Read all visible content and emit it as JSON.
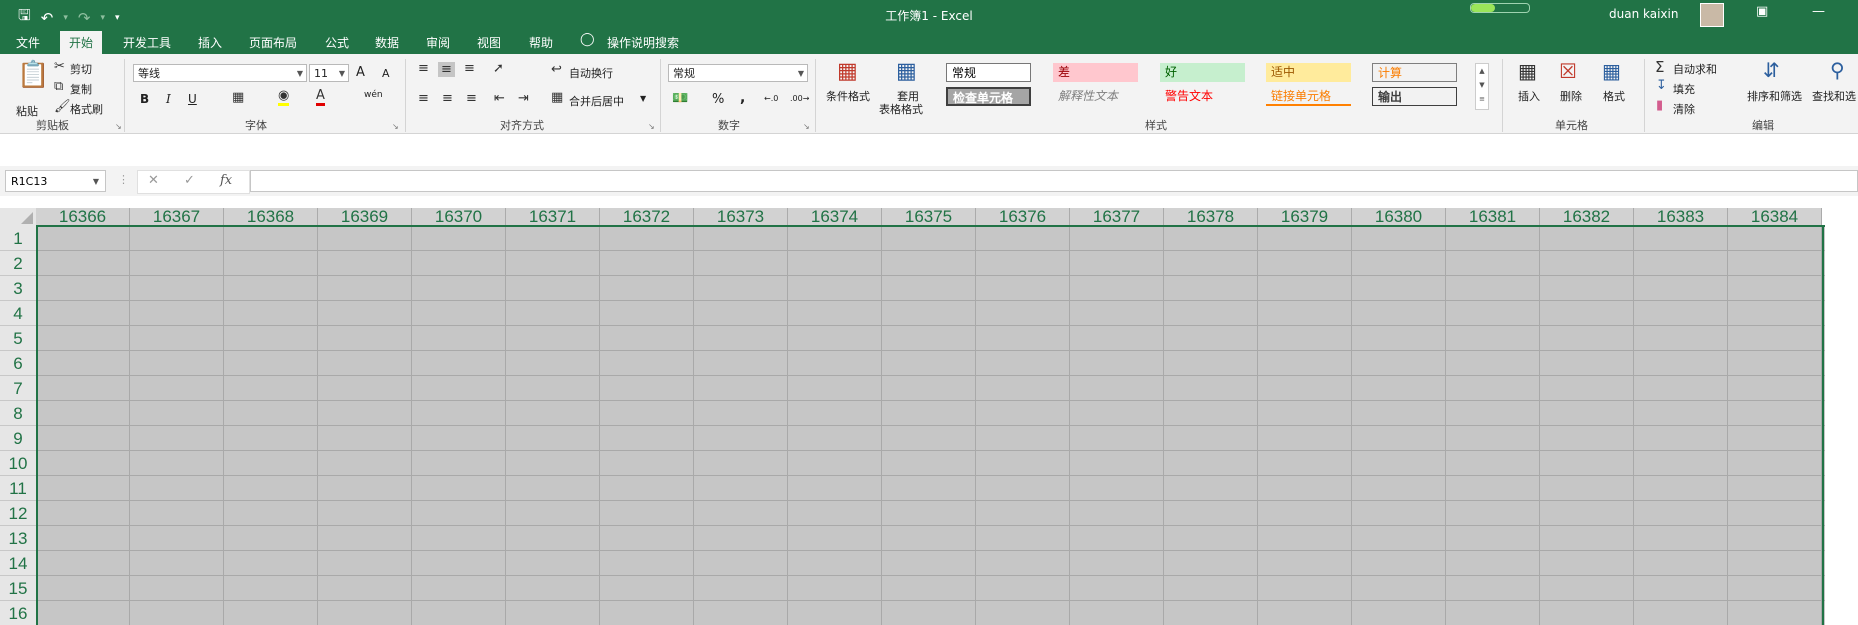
{
  "title": "工作簿1  -  Excel",
  "user": "duan kaixin",
  "qat": {
    "save_icon": "save-icon",
    "undo_icon": "undo-icon",
    "redo_icon": "redo-icon",
    "customize_icon": "customize-icon"
  },
  "tabs": [
    "文件",
    "开始",
    "开发工具",
    "插入",
    "页面布局",
    "公式",
    "数据",
    "审阅",
    "视图",
    "帮助",
    "操作说明搜索"
  ],
  "active_tab": "开始",
  "clipboard": {
    "paste": "粘贴",
    "cut": "剪切",
    "copy": "复制",
    "format_painter": "格式刷",
    "group": "剪贴板"
  },
  "font": {
    "name": "等线",
    "size": "11",
    "bold": "B",
    "italic": "I",
    "underline": "U",
    "group": "字体",
    "grow": "A",
    "shrink": "A",
    "phonetic": "wén"
  },
  "alignment": {
    "wrap": "自动换行",
    "merge": "合并后居中",
    "group": "对齐方式"
  },
  "number": {
    "format": "常规",
    "percent": "%",
    "comma": ",",
    "group": "数字"
  },
  "styles": {
    "conditional": "条件格式",
    "table_l1": "套用",
    "table_l2": "表格格式",
    "group": "样式",
    "cells": [
      "常规",
      "差",
      "好",
      "适中",
      "计算",
      "检查单元格",
      "解释性文本",
      "警告文本",
      "链接单元格",
      "输出"
    ]
  },
  "cells_group": {
    "insert": "插入",
    "delete": "删除",
    "format": "格式",
    "group": "单元格"
  },
  "editing": {
    "autosum": "自动求和",
    "fill": "填充",
    "clear": "清除",
    "sort": "排序和筛选",
    "find": "查找和选",
    "group": "编辑"
  },
  "formula_bar": {
    "name_box": "R1C13",
    "cancel": "✕",
    "enter": "✓",
    "fx": "fx",
    "value": ""
  },
  "colors": {
    "accent": "#217346",
    "selection": "#c6c6c6"
  },
  "columns": [
    "16366",
    "16367",
    "16368",
    "16369",
    "16370",
    "16371",
    "16372",
    "16373",
    "16374",
    "16375",
    "16376",
    "16377",
    "16378",
    "16379",
    "16380",
    "16381",
    "16382",
    "16383",
    "16384"
  ],
  "rows": [
    "1",
    "2",
    "3",
    "4",
    "5",
    "6",
    "7",
    "8",
    "9",
    "10",
    "11",
    "12",
    "13",
    "14",
    "15",
    "16"
  ]
}
